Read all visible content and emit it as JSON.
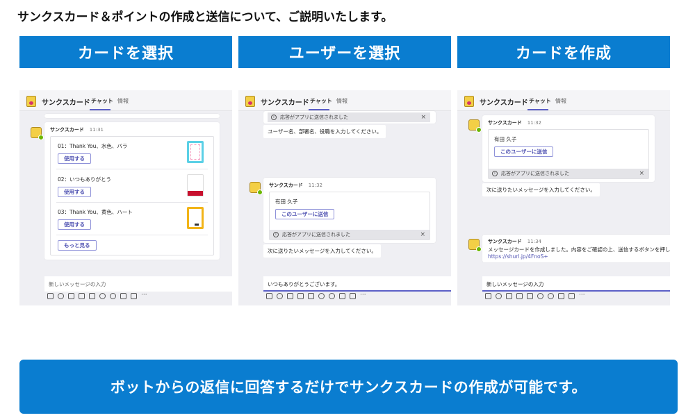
{
  "heading": "サンクスカード＆ポイントの作成と送信について、ご説明いたします。",
  "steps": [
    "カードを選択",
    "ユーザーを選択",
    "カードを作成"
  ],
  "app": {
    "title": "サンクスカード",
    "tab_chat": "チャット",
    "tab_info": "情報"
  },
  "panel1": {
    "sender": "サンクスカード",
    "time": "11:31",
    "cards": [
      {
        "label": "01：Thank You、水色、バラ",
        "button": "使用する"
      },
      {
        "label": "02：いつもありがとう",
        "button": "使用する"
      },
      {
        "label": "03：Thank You、黄色、ハート",
        "button": "使用する"
      }
    ],
    "more_button": "もっと見る",
    "compose_placeholder": "新しいメッセージの入力"
  },
  "panel2": {
    "notice": "応答がアプリに送信されました",
    "prompt1": "ユーザー名、部署名、役職を入力してください。",
    "sender": "サンクスカード",
    "time": "11:32",
    "user_name": "有田 久子",
    "send_button": "このユーザーに送信",
    "notice2": "応答がアプリに送信されました",
    "prompt2": "次に送りたいメッセージを入力してください。",
    "compose_text": "いつもありがとうございます。"
  },
  "panel3": {
    "sender": "サンクスカード",
    "time1": "11:32",
    "user_name": "有田 久子",
    "send_button": "このユーザーに送信",
    "notice": "応答がアプリに送信されました",
    "prompt": "次に送りたいメッセージを入力してください。",
    "time2": "11:34",
    "result_text": "メッセージカードを作成しました。内容をご確認の上、送信するボタンを押して",
    "result_link": "https://shurl.jp/4FnoS+",
    "compose_placeholder": "新しいメッセージの入力"
  },
  "footer": "ボットからの返信に回答するだけでサンクスカードの作成が可能です。"
}
